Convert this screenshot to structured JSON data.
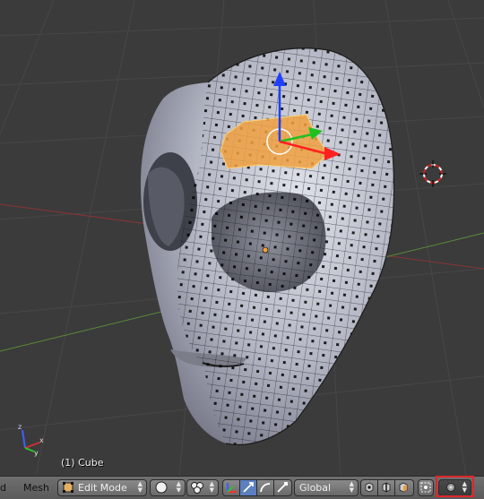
{
  "viewport": {
    "object_info": "(1) Cube"
  },
  "header": {
    "partial_left_label": "d",
    "mesh_menu": "Mesh",
    "mode_select": "Edit Mode",
    "orientation_select": "Global"
  },
  "colors": {
    "viewport_bg": "#3b3b3b",
    "grid_line": "#4a4a4a",
    "x_axis_line": "#8a3434",
    "y_axis_line": "#5a8a3a",
    "mesh_fill": "#b9bcc7",
    "selected_face": "#f0a040",
    "manipulator_z": "#2040ff",
    "manipulator_y": "#20c020",
    "manipulator_x": "#ff2020",
    "header_bg": "#666666",
    "highlight_box": "#e0262a"
  },
  "icons": [
    "mode-icon",
    "viewport-shading-icon",
    "pivot-point-icon",
    "manipulator-icon",
    "translate-icon",
    "rotate-icon",
    "scale-icon",
    "vertex-select-icon",
    "edge-select-icon",
    "face-select-icon",
    "occlude-geometry-icon",
    "proportional-editing-icon",
    "axes-icon",
    "3d-cursor-icon"
  ]
}
